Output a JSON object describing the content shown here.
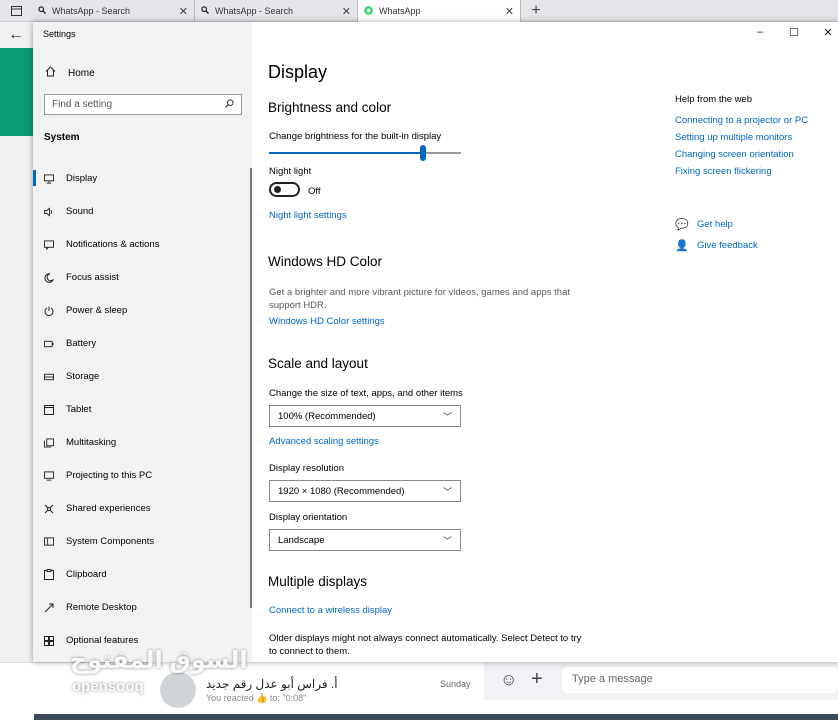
{
  "browser": {
    "tabs": [
      {
        "label": "WhatsApp - Search",
        "icon": "search-icon"
      },
      {
        "label": "WhatsApp - Search",
        "icon": "search-icon"
      },
      {
        "label": "WhatsApp",
        "icon": "whatsapp-icon"
      }
    ],
    "new_tab": "+"
  },
  "settings": {
    "window_title": "Settings",
    "home_label": "Home",
    "search_placeholder": "Find a setting",
    "section": "System",
    "nav": [
      {
        "label": "Display",
        "icon": "monitor-icon"
      },
      {
        "label": "Sound",
        "icon": "speaker-icon"
      },
      {
        "label": "Notifications & actions",
        "icon": "notification-icon"
      },
      {
        "label": "Focus assist",
        "icon": "moon-icon"
      },
      {
        "label": "Power & sleep",
        "icon": "power-icon"
      },
      {
        "label": "Battery",
        "icon": "battery-icon"
      },
      {
        "label": "Storage",
        "icon": "storage-icon"
      },
      {
        "label": "Tablet",
        "icon": "tablet-icon"
      },
      {
        "label": "Multitasking",
        "icon": "multitasking-icon"
      },
      {
        "label": "Projecting to this PC",
        "icon": "projector-icon"
      },
      {
        "label": "Shared experiences",
        "icon": "share-icon"
      },
      {
        "label": "System Components",
        "icon": "components-icon"
      },
      {
        "label": "Clipboard",
        "icon": "clipboard-icon"
      },
      {
        "label": "Remote Desktop",
        "icon": "remote-desktop-icon"
      },
      {
        "label": "Optional features",
        "icon": "features-icon"
      }
    ],
    "page_title": "Display",
    "brightness": {
      "heading": "Brightness and color",
      "slider_label": "Change brightness for the built-in display",
      "slider_value_percent": 80,
      "night_light_label": "Night light",
      "night_light_state": "Off",
      "night_light_link": "Night light settings"
    },
    "hdr": {
      "heading": "Windows HD Color",
      "description": "Get a brighter and more vibrant picture for videos, games and apps that support HDR.",
      "link": "Windows HD Color settings"
    },
    "scale": {
      "heading": "Scale and layout",
      "size_label": "Change the size of text, apps, and other items",
      "size_value": "100% (Recommended)",
      "advanced_link": "Advanced scaling settings",
      "resolution_label": "Display resolution",
      "resolution_value": "1920 × 1080 (Recommended)",
      "orientation_label": "Display orientation",
      "orientation_value": "Landscape"
    },
    "multiple": {
      "heading": "Multiple displays",
      "link": "Connect to a wireless display",
      "description": "Older displays might not always connect automatically. Select Detect to try to connect to them."
    },
    "help": {
      "title": "Help from the web",
      "links": [
        "Connecting to a projector or PC",
        "Setting up multiple monitors",
        "Changing screen orientation",
        "Fixing screen flickering"
      ],
      "get_help": "Get help",
      "give_feedback": "Give feedback"
    }
  },
  "whatsapp": {
    "chat_name": "أ. فراس أبو عدل رقم جديد",
    "chat_time": "Sunday",
    "chat_preview": "You reacted 👍 to: \"0:08\"",
    "message_placeholder": "Type a message"
  },
  "watermark": {
    "arabic": "السوق المفتوح",
    "latin": "opensooq"
  },
  "colors": {
    "accent": "#0067c0",
    "whatsapp_green": "#0b9b73"
  }
}
